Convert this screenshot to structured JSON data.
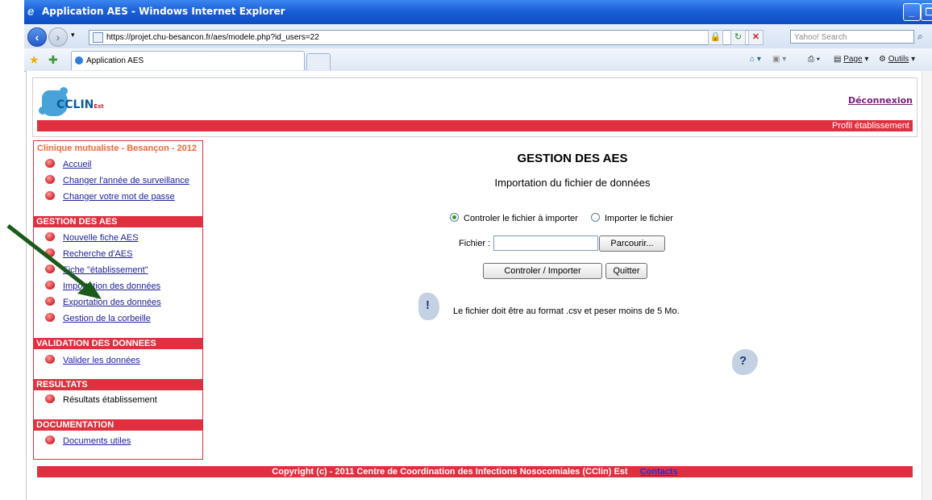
{
  "window": {
    "title": "Application AES - Windows Internet Explorer",
    "buttons": [
      "_",
      "❐",
      "X"
    ]
  },
  "addressbar": {
    "url": "https://projet.chu-besancon.fr/aes/modele.php?id_users=22",
    "search_placeholder": "Yahoo! Search"
  },
  "tabs": {
    "active_label": "Application AES"
  },
  "commandbar": {
    "page_label": "Page",
    "tools_label": "Outils"
  },
  "header": {
    "logo_text": "CCLIN",
    "logo_sub": "Est",
    "logout_label": "Déconnexion",
    "profile_label": "Profil établissement"
  },
  "sidebar": {
    "title": "Clinique mutualiste - Besançon - 2012",
    "top_items": [
      "Accueil",
      "Changer l'année de surveillance",
      "Changer votre mot de passe"
    ],
    "sections": [
      {
        "heading": "GESTION DES AES",
        "items": [
          "Nouvelle fiche AES",
          "Recherche d'AES",
          "Fiche \"établissement\"",
          "Importation des données",
          "Exportation des données",
          "Gestion de la corbeille"
        ]
      },
      {
        "heading": "VALIDATION DES DONNEES",
        "items": [
          "Valider les données"
        ]
      },
      {
        "heading": "RESULTATS",
        "items": [
          "Résultats établissement"
        ]
      },
      {
        "heading": "DOCUMENTATION",
        "items": [
          "Documents utiles"
        ]
      }
    ]
  },
  "main": {
    "title": "GESTION DES AES",
    "subtitle": "Importation du fichier de données",
    "radio_options": [
      "Controler le fichier à importer",
      "Importer le fichier"
    ],
    "radio_selected": "Controler le fichier à importer",
    "file_label": "Fichier :",
    "browse_label": "Parcourir...",
    "submit_label": "Controler / Importer",
    "quit_label": "Quitter",
    "info_text": "Le fichier doit être au format .csv et peser moins de 5 Mo."
  },
  "footer": {
    "copyright": "Copyright (c) - 2011 Centre de Coordination des Infections Nosocomiales (CClin) Est",
    "contacts_label": "Contacts"
  },
  "colors": {
    "accent_red": "#e0303f",
    "link_blue": "#20209a",
    "ie_blue": "#1b5fd6"
  }
}
